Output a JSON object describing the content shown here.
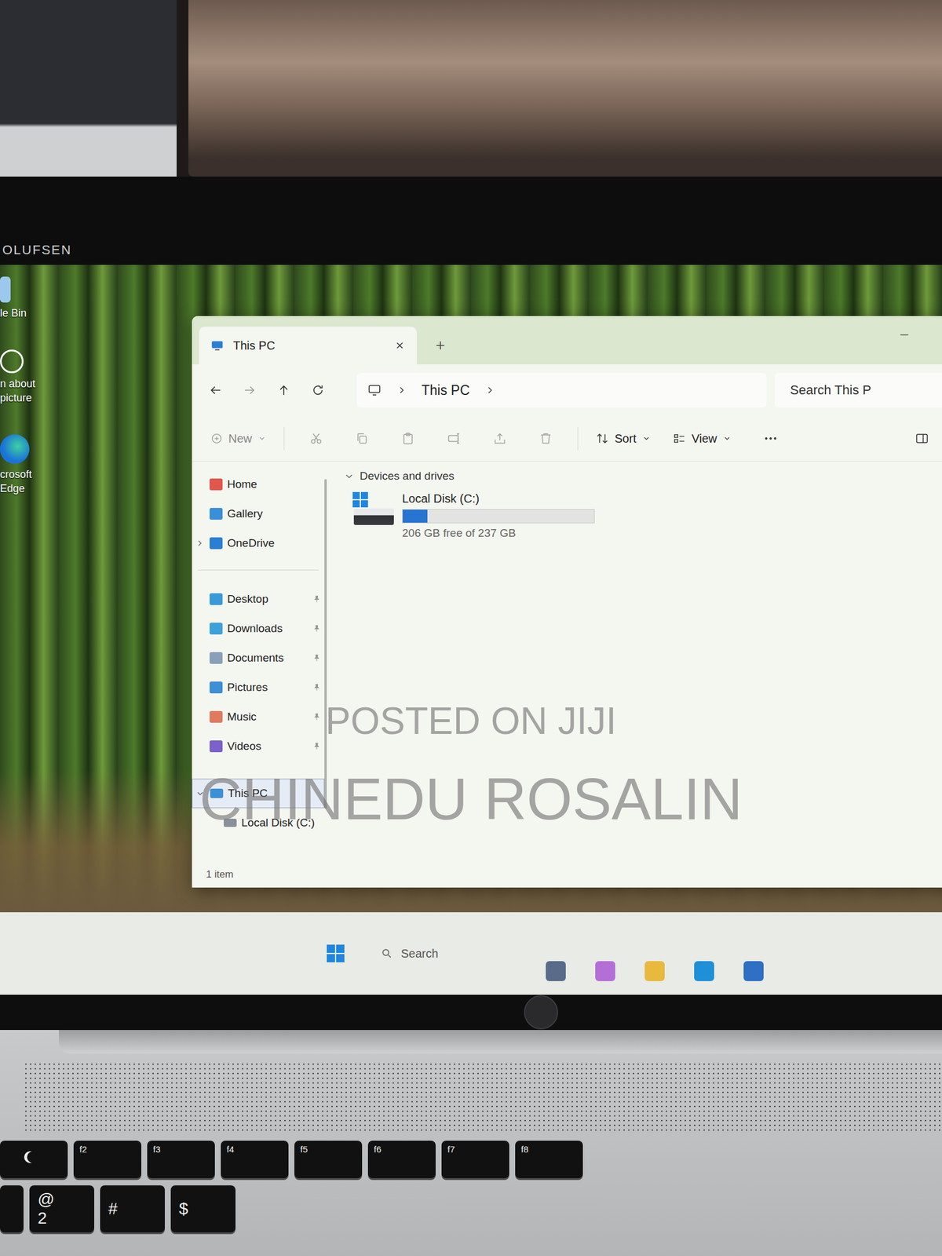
{
  "brand": "OLUFSEN",
  "desktop_icons": [
    {
      "lines": [
        "le Bin"
      ]
    },
    {
      "lines": [
        "n about",
        "picture"
      ]
    },
    {
      "lines": [
        "crosoft",
        "Edge"
      ]
    }
  ],
  "window": {
    "title": "This PC"
  },
  "address": {
    "crumbs": [
      "This PC"
    ],
    "search_placeholder": "Search This P"
  },
  "toolbar": {
    "new": "New",
    "sort": "Sort",
    "view": "View",
    "actions_disabled": true
  },
  "sidebar": {
    "top": [
      {
        "label": "Home",
        "expandable": false,
        "expanded": false
      },
      {
        "label": "Gallery",
        "expandable": false,
        "expanded": false
      },
      {
        "label": "OneDrive",
        "expandable": true,
        "expanded": false
      }
    ],
    "pinned": [
      {
        "label": "Desktop",
        "pinned": true
      },
      {
        "label": "Downloads",
        "pinned": true
      },
      {
        "label": "Documents",
        "pinned": true
      },
      {
        "label": "Pictures",
        "pinned": true
      },
      {
        "label": "Music",
        "pinned": true
      },
      {
        "label": "Videos",
        "pinned": true
      }
    ],
    "tree": [
      {
        "label": "This PC",
        "expandable": true,
        "expanded": true,
        "selected": true,
        "depth": 0
      },
      {
        "label": "Local Disk (C:)",
        "expandable": false,
        "expanded": false,
        "selected": false,
        "depth": 1
      }
    ]
  },
  "content": {
    "group": {
      "label": "Devices and drives",
      "expanded": true
    },
    "drives": [
      {
        "name": "Local Disk (C:)",
        "level": 0.13,
        "free_text": "206 GB free of 237 GB"
      }
    ]
  },
  "status_bar": "1 item",
  "watermark": [
    "POSTED ON JIJI",
    "CHINEDU ROSALIN"
  ],
  "taskbar": {
    "search_placeholder": "Search"
  },
  "keyboard": {
    "function_keys": [
      "f2",
      "f3",
      "f4",
      "f5",
      "f6",
      "f7",
      "f8"
    ],
    "number_keys": [
      {
        "top": "@",
        "bottom": "2"
      },
      {
        "top": "#",
        "bottom": ""
      },
      {
        "top": "$",
        "bottom": ""
      }
    ]
  }
}
